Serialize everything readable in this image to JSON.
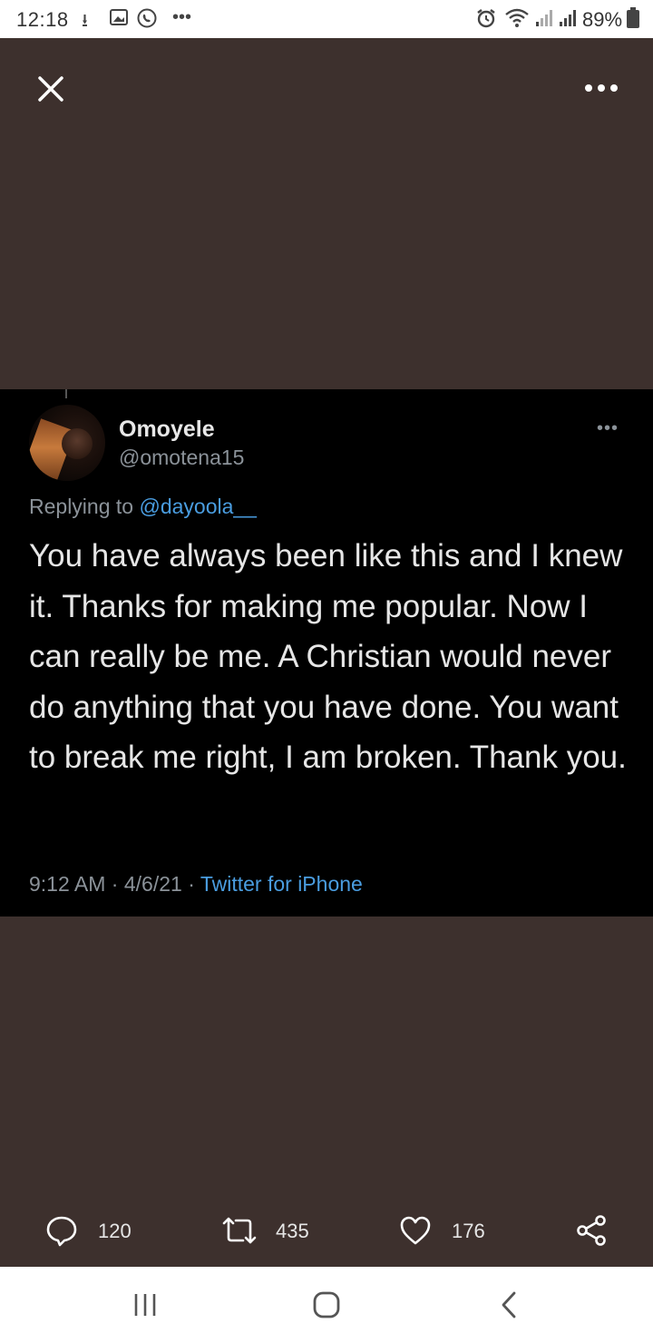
{
  "status_bar": {
    "time": "12:18",
    "battery": "89%",
    "icons": [
      "download-icon",
      "image-icon",
      "whatsapp-icon",
      "more-dots-icon",
      "alarm-icon",
      "wifi-icon",
      "signal-icon",
      "signal-icon",
      "battery-icon"
    ]
  },
  "top_bar": {
    "close_icon": "close-icon",
    "more_icon": "more-horizontal-icon"
  },
  "tweet": {
    "display_name": "Omoyele",
    "handle": "@omotena15",
    "replying_prefix": "Replying to",
    "replying_to": "@dayoola__",
    "text": "You have always been like this and I knew it. Thanks for making me popular. Now I can really be me. A Christian would never do anything that you have done. You want to break me right, I am broken. Thank you.",
    "time": "9:12 AM",
    "date": "4/6/21",
    "separator": "·",
    "source": "Twitter for iPhone",
    "more_label": "•••"
  },
  "actions": {
    "replies": "120",
    "retweets": "435",
    "likes": "176"
  },
  "colors": {
    "background": "#3d302d",
    "card": "#000000",
    "link": "#4a9de0",
    "secondary_text": "#8b9299"
  }
}
